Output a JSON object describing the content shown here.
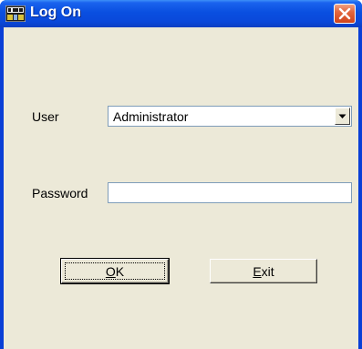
{
  "window": {
    "title": "Log On",
    "icon": "dme-app-icon",
    "close_icon": "close-icon"
  },
  "form": {
    "user_label": "User",
    "user_value": "Administrator",
    "password_label": "Password",
    "password_value": ""
  },
  "buttons": {
    "ok_mnemonic": "O",
    "ok_rest": "K",
    "exit_mnemonic": "E",
    "exit_rest": "xit"
  },
  "colors": {
    "titlebar": "#0a4fe0",
    "client_background": "#ece9d8",
    "close_button": "#d0441b"
  }
}
